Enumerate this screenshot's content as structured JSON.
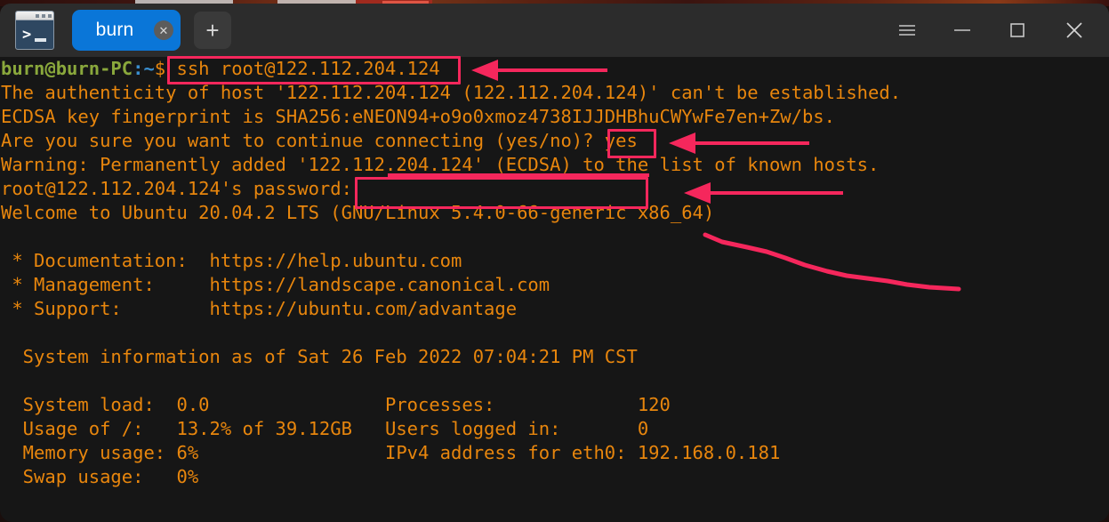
{
  "window": {
    "app_icon_name": "terminal-icon",
    "tab": {
      "label": "burn",
      "close_label": "✕"
    },
    "new_tab_label": "+",
    "controls": {
      "menu_label": "☰",
      "minimize_label": "—",
      "maximize_label": "▢",
      "close_label": "✕"
    }
  },
  "terminal": {
    "prompt": {
      "user_host": "burn@burn-PC",
      "path": ":~",
      "symbol": "$",
      "command": " ssh root@122.112.204.124"
    },
    "lines": [
      "The authenticity of host '122.112.204.124 (122.112.204.124)' can't be established.",
      "ECDSA key fingerprint is SHA256:eNEON94+o9o0xmoz4738IJJDHBhuCWYwFe7en+Zw/bs.",
      "Are you sure you want to continue connecting (yes/no)? yes",
      "Warning: Permanently added '122.112.204.124' (ECDSA) to the list of known hosts.",
      "root@122.112.204.124's password:",
      "Welcome to Ubuntu 20.04.2 LTS (GNU/Linux 5.4.0-66-generic x86_64)",
      "",
      " * Documentation:  https://help.ubuntu.com",
      " * Management:     https://landscape.canonical.com",
      " * Support:        https://ubuntu.com/advantage",
      "",
      "  System information as of Sat 26 Feb 2022 07:04:21 PM CST",
      "",
      "  System load:  0.0                Processes:             120",
      "  Usage of /:   13.2% of 39.12GB   Users logged in:       0",
      "  Memory usage: 6%                 IPv4 address for eth0: 192.168.0.181",
      "  Swap usage:   0%"
    ],
    "system_info": {
      "header": "System information as of Sat 26 Feb 2022 07:04:21 PM CST",
      "timestamp": "Sat 26 Feb 2022 07:04:21 PM CST",
      "system_load": "0.0",
      "usage_of_root": "13.2% of 39.12GB",
      "memory_usage": "6%",
      "swap_usage": "0%",
      "processes": "120",
      "users_logged_in": "0",
      "ipv4_address_eth0": "192.168.0.181",
      "ipv4_label": "IPv4 address for eth0:"
    },
    "links": {
      "documentation": "https://help.ubuntu.com",
      "management": "https://landscape.canonical.com",
      "support": "https://ubuntu.com/advantage"
    },
    "host_ip": "122.112.204.124",
    "fingerprint": "SHA256:eNEON94+o9o0xmoz4738IJJDHBhuCWYwFe7en+Zw/bs.",
    "answer": "yes",
    "os_release": "Ubuntu 20.04.2 LTS",
    "kernel": "GNU/Linux 5.4.0-66-generic x86_64"
  },
  "annotations": {
    "accent_color": "#f5275c",
    "command_box_label": "ssh-command-highlight",
    "yes_box_label": "yes-answer-highlight",
    "password_box_label": "password-entry-highlight",
    "underline_label": "known-hosts-underline",
    "freehand_label": "welcome-freehand-underline"
  },
  "colors": {
    "terminal_background": "#161616",
    "titlebar_background": "#2c2c2c",
    "text_orange": "#e8860d",
    "prompt_green": "#8aa83c",
    "prompt_blue": "#3a8fd0",
    "tab_blue": "#0a76d8",
    "annotation_pink": "#f5275c"
  }
}
